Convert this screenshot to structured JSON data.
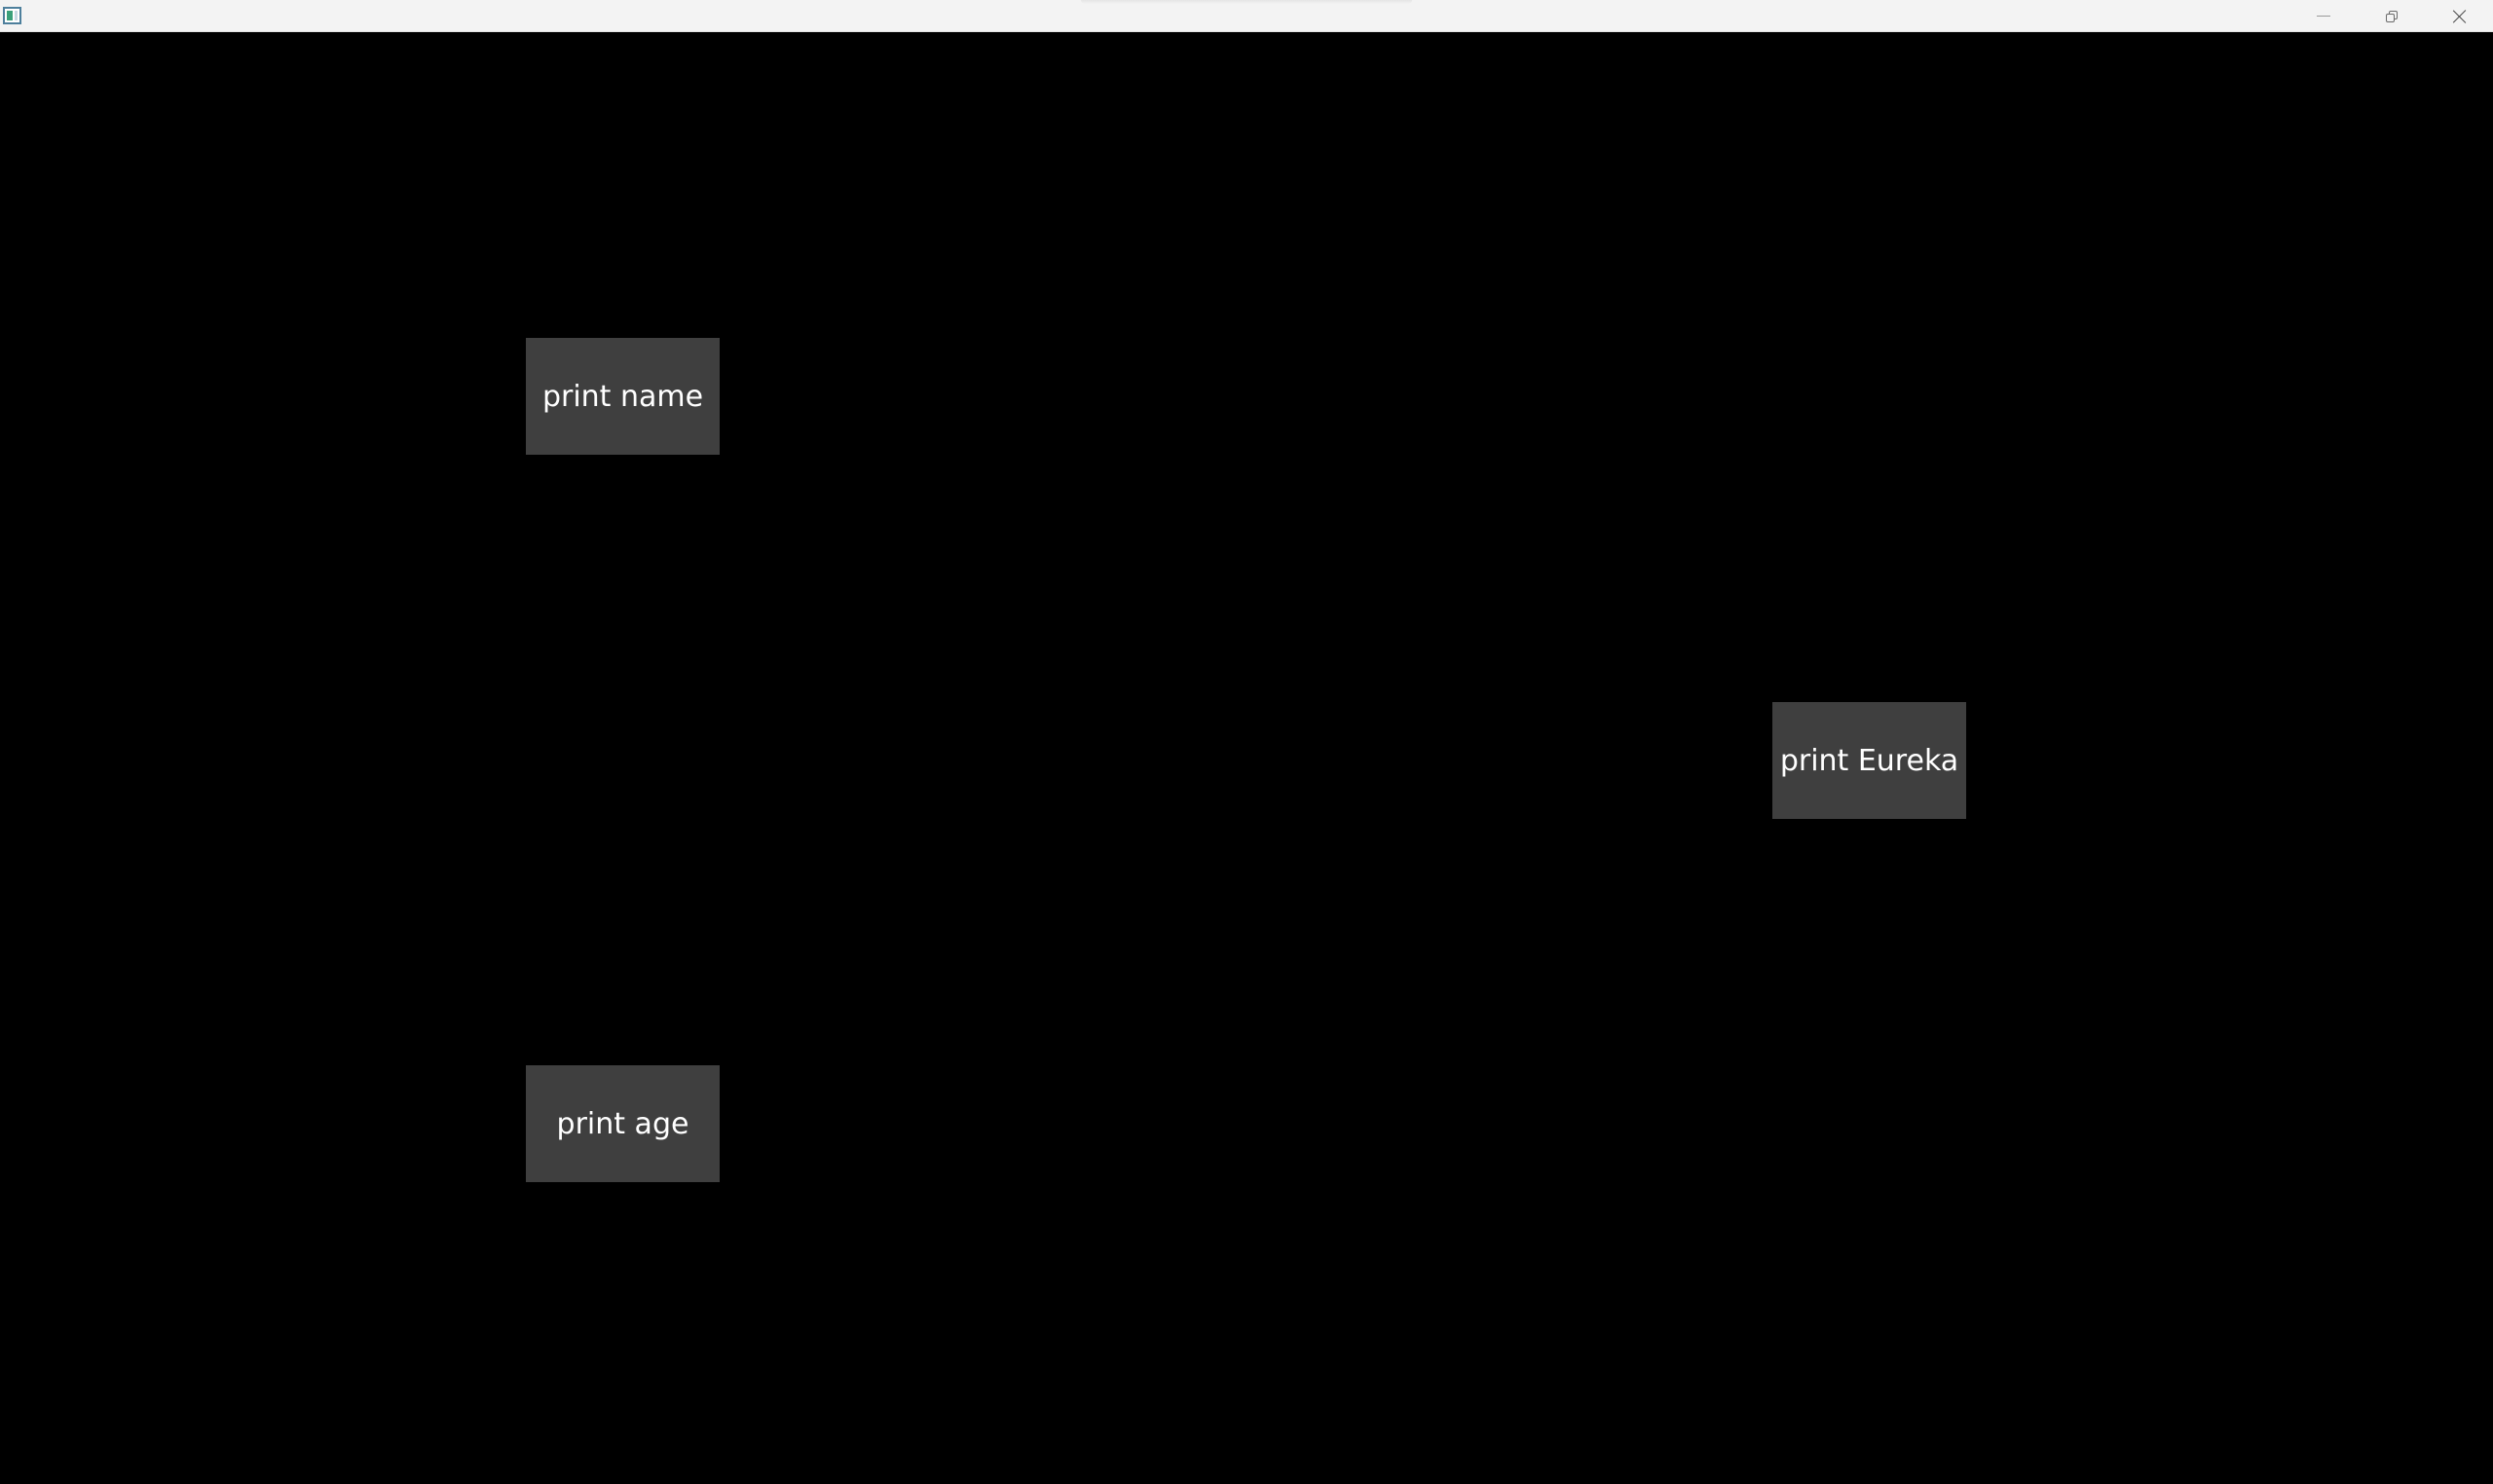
{
  "window": {
    "icon": "app-window-icon",
    "controls": {
      "minimize_icon": "minimize-icon",
      "restore_icon": "restore-icon",
      "close_icon": "close-icon"
    }
  },
  "buttons": {
    "print_name": "print name",
    "print_age": "print age",
    "print_eureka": "print Eureka"
  },
  "colors": {
    "background": "#000000",
    "button_bg": "#3f3f3f",
    "button_text": "#ffffff",
    "titlebar_bg": "#f3f3f3"
  }
}
